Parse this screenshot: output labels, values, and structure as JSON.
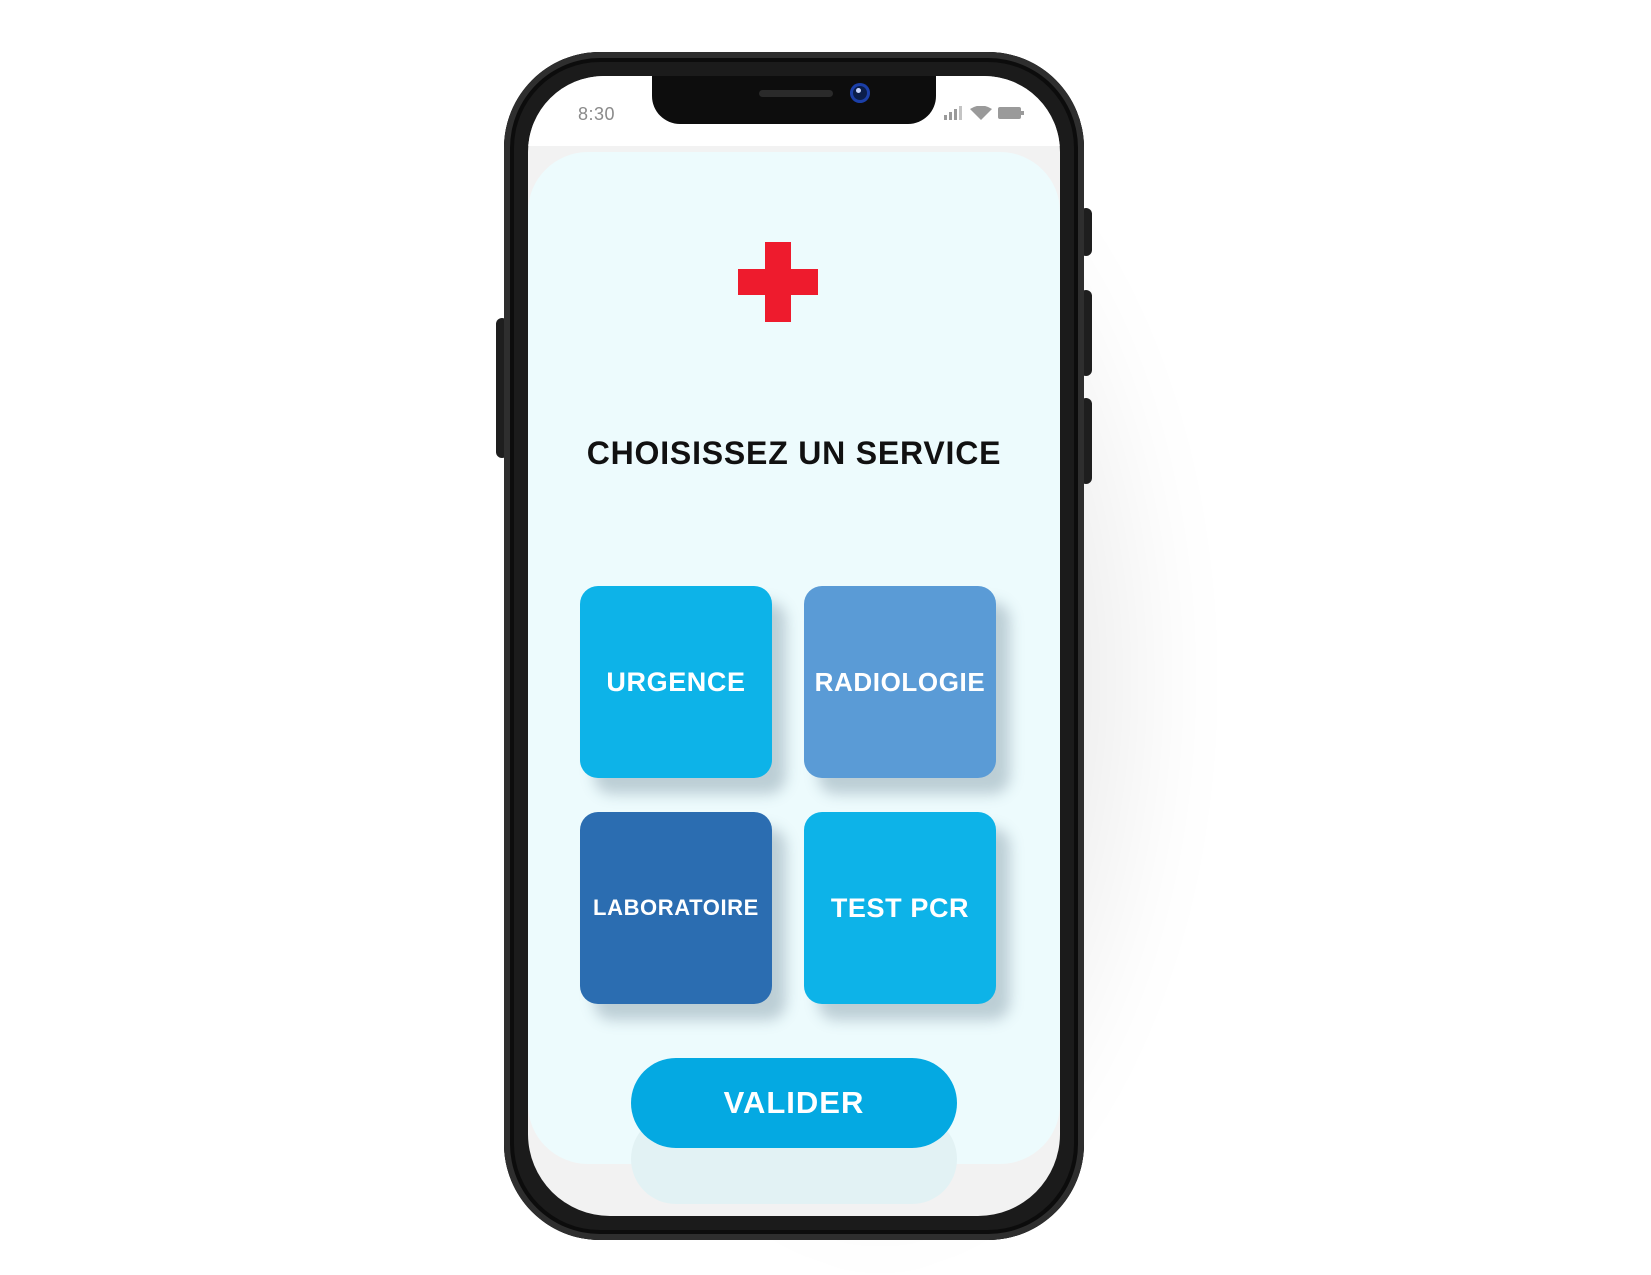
{
  "status_bar": {
    "time": "8:30",
    "icons": [
      "signal-icon",
      "wifi-icon",
      "battery-icon"
    ]
  },
  "app": {
    "logo_icon": "medical-cross-icon",
    "title": "CHOISISSEZ UN SERVICE",
    "services": [
      {
        "label": "URGENCE",
        "color": "#0db3e8"
      },
      {
        "label": "RADIOLOGIE",
        "color": "#5a9bd6"
      },
      {
        "label": "LABORATOIRE",
        "color": "#2b6db1"
      },
      {
        "label": "TEST PCR",
        "color": "#0db3e8"
      }
    ],
    "validate_label": "VALIDER",
    "colors": {
      "cross": "#ee1b2d",
      "background": "#edfbfd",
      "accent": "#04a9e2"
    }
  }
}
